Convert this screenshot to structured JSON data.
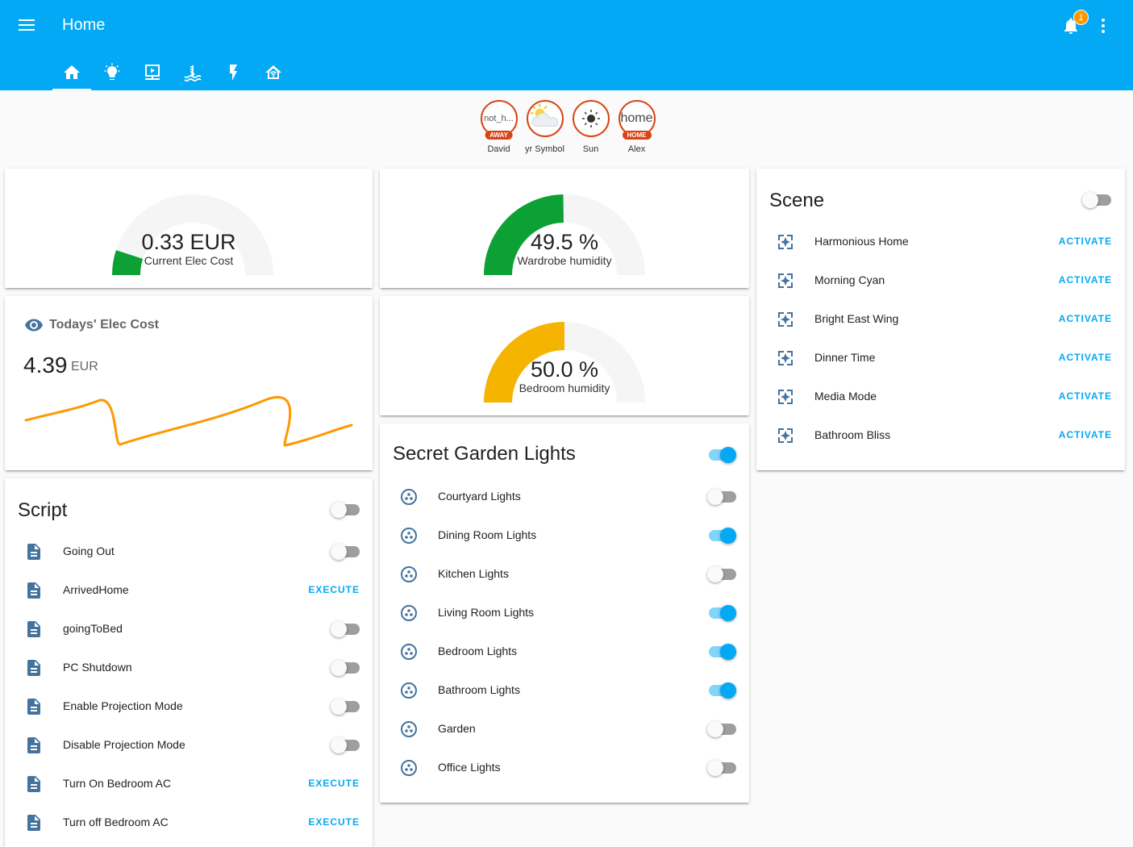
{
  "header": {
    "title": "Home",
    "notifications_count": "1",
    "views": [
      {
        "icon": "home-icon",
        "active": true
      },
      {
        "icon": "lightbulb-icon",
        "active": false
      },
      {
        "icon": "media-player-icon",
        "active": false
      },
      {
        "icon": "heating-icon",
        "active": false
      },
      {
        "icon": "flash-icon",
        "active": false
      },
      {
        "icon": "home-automation-icon",
        "active": false
      }
    ],
    "accent_color": "#03a9f4"
  },
  "badges": [
    {
      "value": "not_h...",
      "tag": "AWAY",
      "label": "David"
    },
    {
      "value": "",
      "tag": "",
      "label": "yr Symbol",
      "icon": "partly-cloudy-icon"
    },
    {
      "value": "",
      "tag": "",
      "label": "Sun",
      "icon": "sun-icon"
    },
    {
      "value": "home",
      "tag": "HOME",
      "label": "Alex"
    }
  ],
  "gauges": {
    "elec_cost": {
      "value": "0.33 EUR",
      "name": "Current Elec Cost",
      "fraction": 0.1,
      "color": "#0da035"
    },
    "wardrobe": {
      "value": "49.5 %",
      "name": "Wardrobe humidity",
      "fraction": 0.495,
      "color": "#0da035"
    },
    "bedroom": {
      "value": "50.0 %",
      "name": "Bedroom humidity",
      "fraction": 0.5,
      "color": "#f4b400"
    }
  },
  "sensor": {
    "name": "Todays' Elec Cost",
    "value": "4.39",
    "unit": "EUR",
    "icon": "eye-icon",
    "line_color": "#ff9800"
  },
  "script": {
    "title": "Script",
    "master_on": false,
    "items": [
      {
        "name": "Going Out",
        "type": "toggle",
        "on": false
      },
      {
        "name": "ArrivedHome",
        "type": "button",
        "action": "EXECUTE"
      },
      {
        "name": "goingToBed",
        "type": "toggle",
        "on": false
      },
      {
        "name": "PC Shutdown",
        "type": "toggle",
        "on": false
      },
      {
        "name": "Enable Projection Mode",
        "type": "toggle",
        "on": false
      },
      {
        "name": "Disable Projection Mode",
        "type": "toggle",
        "on": false
      },
      {
        "name": "Turn On Bedroom AC",
        "type": "button",
        "action": "EXECUTE"
      },
      {
        "name": "Turn off Bedroom AC",
        "type": "button",
        "action": "EXECUTE"
      }
    ]
  },
  "lights": {
    "title": "Secret Garden Lights",
    "master_on": true,
    "items": [
      {
        "name": "Courtyard Lights",
        "on": false
      },
      {
        "name": "Dining Room Lights",
        "on": true
      },
      {
        "name": "Kitchen Lights",
        "on": false
      },
      {
        "name": "Living Room Lights",
        "on": true
      },
      {
        "name": "Bedroom Lights",
        "on": true
      },
      {
        "name": "Bathroom Lights",
        "on": true
      },
      {
        "name": "Garden",
        "on": false
      },
      {
        "name": "Office Lights",
        "on": false
      }
    ]
  },
  "scene": {
    "title": "Scene",
    "master_on": false,
    "items": [
      {
        "name": "Harmonious Home",
        "action": "ACTIVATE"
      },
      {
        "name": "Morning Cyan",
        "action": "ACTIVATE"
      },
      {
        "name": "Bright East Wing",
        "action": "ACTIVATE"
      },
      {
        "name": "Dinner Time",
        "action": "ACTIVATE"
      },
      {
        "name": "Media Mode",
        "action": "ACTIVATE"
      },
      {
        "name": "Bathroom Bliss",
        "action": "ACTIVATE"
      }
    ]
  }
}
